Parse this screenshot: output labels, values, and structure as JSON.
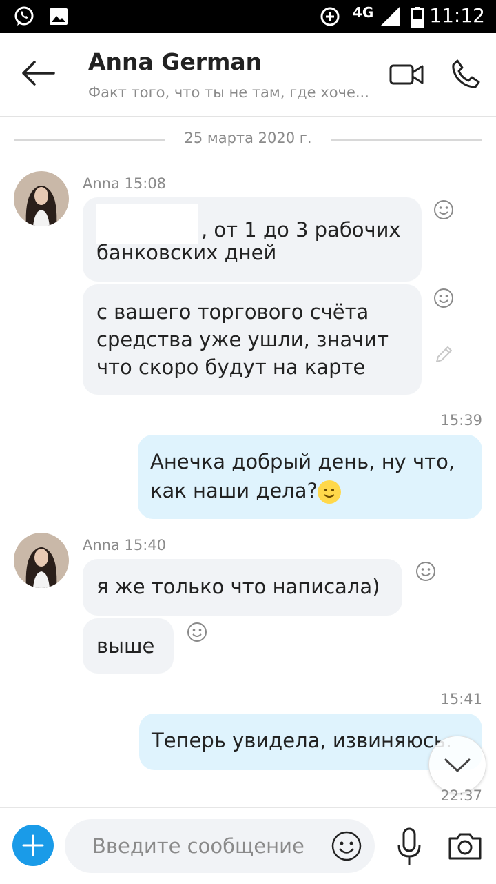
{
  "status_bar": {
    "network": "4G",
    "time": "11:12"
  },
  "header": {
    "name": "Anna German",
    "status": "Факт того, что ты не там, где хоче..."
  },
  "date_separator": "25 марта 2020 г.",
  "messages": [
    {
      "sender": "Anna 15:08",
      "bubbles": [
        {
          "line1": ", от 1 до 3 рабочих",
          "line2": "банковских дней"
        },
        {
          "line1": "с вашего торгового счёта",
          "line2": "средства уже ушли, значит",
          "line3": "что скоро будут на карте"
        }
      ]
    },
    {
      "time": "15:39",
      "line1": "Анечка добрый день, ну что,",
      "line2": "как наши дела?"
    },
    {
      "sender": "Anna 15:40",
      "bubbles": [
        {
          "text": "я же только что написала)"
        },
        {
          "text": "выше"
        }
      ]
    },
    {
      "time": "15:41",
      "text": "Теперь увидела, извиняюсь."
    },
    {
      "time": "22:37"
    }
  ],
  "composer": {
    "placeholder": "Введите сообщение"
  },
  "icons": {
    "whatsapp": "whatsapp-icon",
    "gallery": "image-icon",
    "data_saver": "data-saver-icon",
    "signal": "signal-icon",
    "battery": "battery-icon",
    "back": "arrow-left-icon",
    "video": "video-camera-icon",
    "call": "phone-icon",
    "reaction": "smiley-icon",
    "edit": "pencil-icon",
    "add": "plus-icon",
    "emoji": "emoji-icon",
    "mic": "microphone-icon",
    "camera": "camera-icon",
    "scroll": "chevron-down-icon"
  },
  "colors": {
    "accent": "#1a9be8",
    "incoming_bubble": "#f1f3f6",
    "outgoing_bubble": "#dff3fd"
  }
}
